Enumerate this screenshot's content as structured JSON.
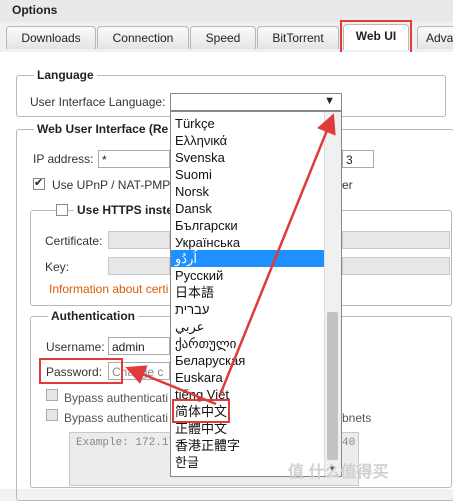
{
  "window": {
    "title": "Options"
  },
  "tabs": [
    {
      "label": "Downloads"
    },
    {
      "label": "Connection"
    },
    {
      "label": "Speed"
    },
    {
      "label": "BitTorrent"
    },
    {
      "label": "Web UI"
    },
    {
      "label": "Adva"
    }
  ],
  "language_section": {
    "legend": "Language",
    "ui_language_label": "User Interface Language:",
    "dropdown_arrow": "▼"
  },
  "language_dropdown": {
    "options": [
      "Türkçe",
      "Ελληνικά",
      "Svenska",
      "Suomi",
      "Norsk",
      "Dansk",
      "Български",
      "Українська",
      "اُردُو",
      "Русский",
      "日本語",
      "עברית",
      "عربي",
      "ქართული",
      "Беларуская",
      "Euskara",
      "tiếng Việt",
      "简体中文",
      "正體中文",
      "香港正體字",
      "한글"
    ],
    "highlighted": "اُردُو",
    "marked": "简体中文"
  },
  "webui_section": {
    "legend": "Web User Interface (Re",
    "ip_label": "IP address:",
    "ip_value": "*",
    "port_value": "3",
    "upnp_label": "Use UPnP / NAT-PMP",
    "upnp_suffix": "er",
    "https_label": "Use HTTPS inste",
    "certificate_label": "Certificate:",
    "key_label": "Key:",
    "info_link": "Information about certi"
  },
  "auth_section": {
    "legend": "Authentication",
    "username_label": "Username:",
    "username_value": "admin",
    "password_label": "Password:",
    "password_placeholder": "Change c",
    "bypass_local": "Bypass authenticati",
    "bypass_whitelist": "Bypass authenticati",
    "bypass_whitelist_suffix": "bnets",
    "example_text": "Example: 172.17",
    "example_suffix": "40"
  },
  "watermark": "值 什么值得买",
  "colors": {
    "annotation": "#e03a3a",
    "selection": "#1e90ff",
    "link": "#e05a00"
  }
}
